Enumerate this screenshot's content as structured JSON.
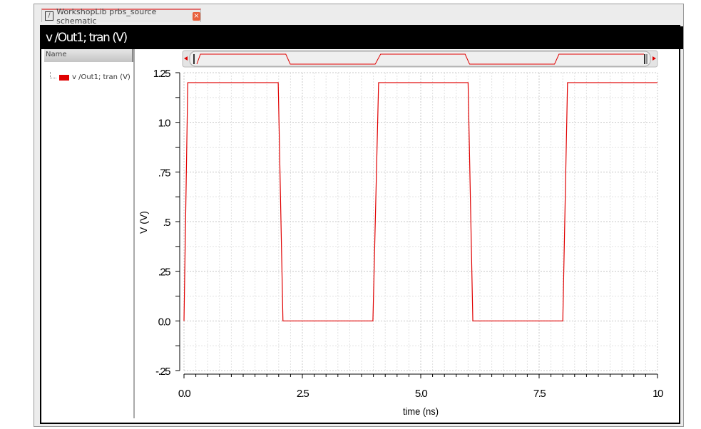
{
  "tab": {
    "label": "WorkshopLib prbs_source schematic",
    "close": "×"
  },
  "title": "v /Out1; tran (V)",
  "panel": {
    "header": "Name",
    "legend": "v /Out1; tran (V)",
    "legend_color": "#e00000"
  },
  "chart_data": {
    "type": "line",
    "title": "v /Out1; tran (V)",
    "xlabel": "time (ns)",
    "ylabel": "V (V)",
    "xlim": [
      0,
      10
    ],
    "ylim": [
      -0.25,
      1.25
    ],
    "xticks": [
      "0.0",
      "2.5",
      "5.0",
      "7.5",
      "10"
    ],
    "yticks": [
      "1.25",
      "1.0",
      ".75",
      ".5",
      ".25",
      "0.0",
      "-.25"
    ],
    "grid": true,
    "series": [
      {
        "name": "v /Out1; tran (V)",
        "color": "#e00000",
        "x": [
          0,
          0.08,
          1.99,
          2.09,
          3.99,
          4.11,
          6.0,
          6.1,
          8.0,
          8.1,
          10
        ],
        "y": [
          0,
          1.2,
          1.2,
          0,
          0,
          1.2,
          1.2,
          0,
          0,
          1.2,
          1.2
        ]
      }
    ]
  }
}
